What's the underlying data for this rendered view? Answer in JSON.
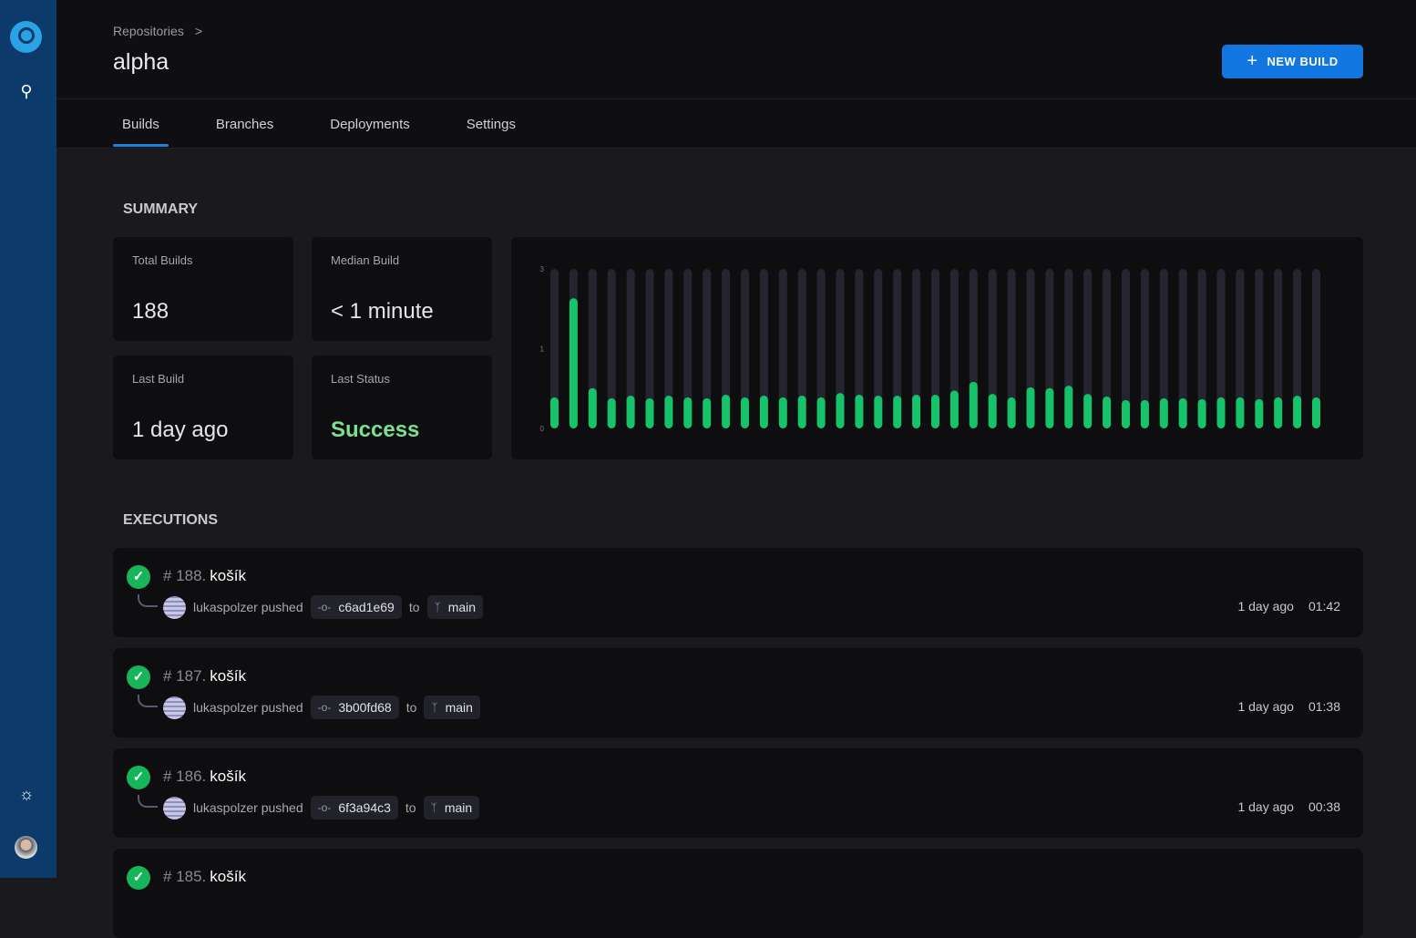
{
  "sidebar": {
    "icons": [
      "logo-icon",
      "search-icon",
      "sun-icon",
      "user-avatar"
    ]
  },
  "header": {
    "breadcrumb": "Repositories",
    "breadcrumb_sep": ">",
    "title": "alpha",
    "new_build": "NEW BUILD",
    "new_build_icon": "+"
  },
  "tabs": [
    {
      "label": "Builds",
      "active": true
    },
    {
      "label": "Branches"
    },
    {
      "label": "Deployments"
    },
    {
      "label": "Settings"
    }
  ],
  "summary": {
    "heading": "SUMMARY",
    "stats": [
      {
        "label": "Total Builds",
        "value": "188"
      },
      {
        "label": "Median Build",
        "value": "< 1 minute"
      },
      {
        "label": "Last Build",
        "value": "1 day ago"
      },
      {
        "label": "Last Status",
        "value": "Success"
      }
    ]
  },
  "colors": {
    "accent": "#1277e1",
    "success": "#16c26a",
    "track": "#25252f"
  },
  "chart_data": {
    "type": "bar",
    "scale": "log(1+y)",
    "yticks": [
      "3",
      "1",
      "0"
    ],
    "ylim": [
      0,
      3
    ],
    "values": [
      0.31,
      2.1,
      0.42,
      0.3,
      0.33,
      0.3,
      0.33,
      0.31,
      0.3,
      0.34,
      0.31,
      0.33,
      0.31,
      0.33,
      0.31,
      0.36,
      0.34,
      0.33,
      0.33,
      0.34,
      0.34,
      0.39,
      0.5,
      0.35,
      0.31,
      0.43,
      0.42,
      0.45,
      0.35,
      0.32,
      0.28,
      0.28,
      0.3,
      0.3,
      0.29,
      0.31,
      0.31,
      0.29,
      0.31,
      0.33,
      0.31
    ]
  },
  "executions": {
    "heading": "EXECUTIONS",
    "items": [
      {
        "number": "# 188.",
        "name": "košík",
        "user": "lukaspolzer pushed",
        "commit": "c6ad1e69",
        "to": "to",
        "branch": "main",
        "when": "1 day ago",
        "duration": "01:42"
      },
      {
        "number": "# 187.",
        "name": "košík",
        "user": "lukaspolzer pushed",
        "commit": "3b00fd68",
        "to": "to",
        "branch": "main",
        "when": "1 day ago",
        "duration": "01:38"
      },
      {
        "number": "# 186.",
        "name": "košík",
        "user": "lukaspolzer pushed",
        "commit": "6f3a94c3",
        "to": "to",
        "branch": "main",
        "when": "1 day ago",
        "duration": "00:38"
      },
      {
        "number": "# 185.",
        "name": "košík"
      }
    ]
  }
}
